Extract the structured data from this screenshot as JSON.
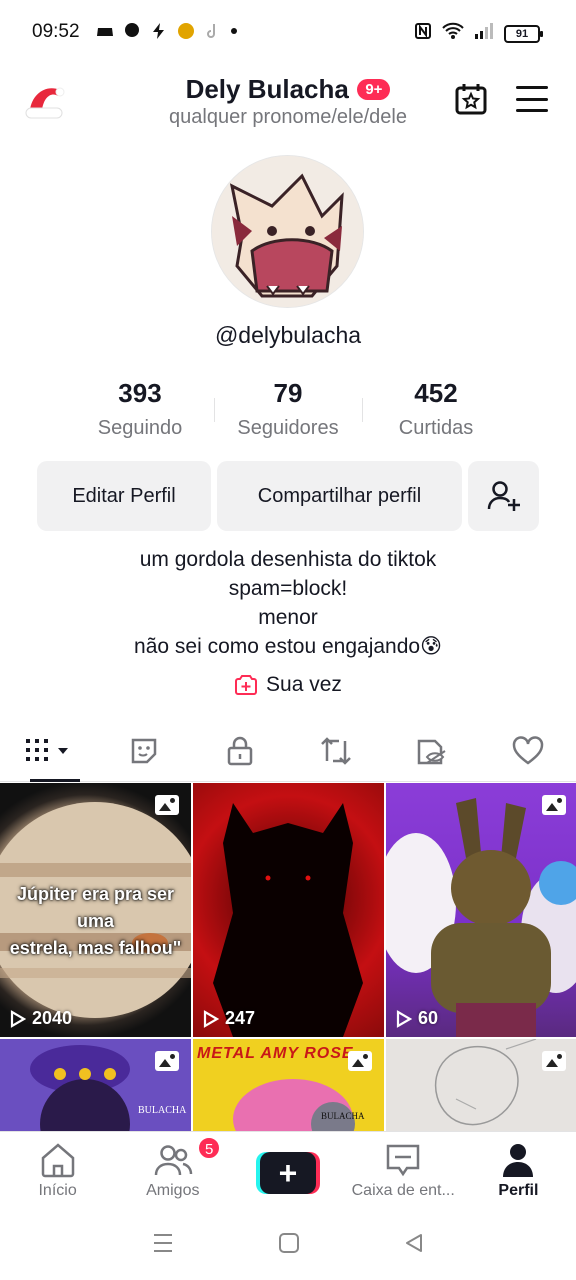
{
  "status_bar": {
    "time": "09:52",
    "battery": "91"
  },
  "header": {
    "name": "Dely Bulacha",
    "badge": "9+",
    "pronouns": "qualquer pronome/ele/dele"
  },
  "profile": {
    "username": "@delybulacha",
    "stats": [
      {
        "value": "393",
        "label": "Seguindo"
      },
      {
        "value": "79",
        "label": "Seguidores"
      },
      {
        "value": "452",
        "label": "Curtidas"
      }
    ],
    "edit_label": "Editar Perfil",
    "share_label": "Compartilhar perfil",
    "bio": [
      "um gordola desenhista do tiktok",
      "spam=block!",
      "menor",
      "não sei como estou engajando😰"
    ],
    "sua_vez": "Sua vez"
  },
  "tabs": [
    {
      "icon": "grid-icon"
    },
    {
      "icon": "sticker-icon"
    },
    {
      "icon": "lock-icon"
    },
    {
      "icon": "repost-icon"
    },
    {
      "icon": "hidden-icon"
    },
    {
      "icon": "heart-icon"
    }
  ],
  "videos": [
    {
      "views": "2040",
      "caption_l1": "Júpiter era pra ser uma",
      "caption_l2": "estrela, mas falhou\""
    },
    {
      "views": "247"
    },
    {
      "views": "60"
    },
    {
      "title": "BULACHA"
    },
    {
      "title": "METAL AMY ROSE",
      "sub": "BULACHA"
    },
    {}
  ],
  "bottom_nav": {
    "home": "Início",
    "friends": "Amigos",
    "friends_badge": "5",
    "inbox": "Caixa de ent...",
    "profile": "Perfil"
  },
  "colors": {
    "accent": "#fe2c55",
    "cyan": "#25f4ee",
    "text": "#161823",
    "muted": "#75767b"
  }
}
